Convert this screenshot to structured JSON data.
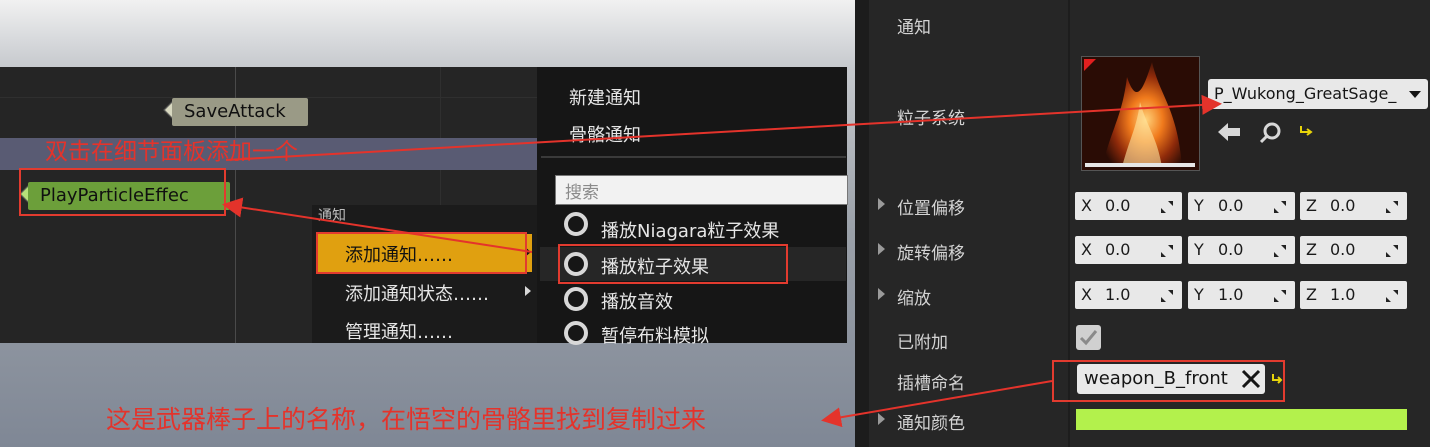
{
  "graph": {
    "notifies": [
      {
        "label": "SaveAttack"
      },
      {
        "label": "PlayParticleEffec"
      }
    ]
  },
  "context_menu": {
    "header": "通知",
    "items": [
      {
        "label": "添加通知……",
        "selected": true,
        "has_submenu": true
      },
      {
        "label": "添加通知状态……",
        "has_submenu": true
      },
      {
        "label": "管理通知……"
      }
    ]
  },
  "submenu": {
    "top_items": [
      "新建通知",
      "骨骼通知"
    ],
    "search_placeholder": "搜索",
    "items": [
      {
        "label": "播放Niagara粒子效果"
      },
      {
        "label": "播放粒子效果",
        "highlighted": true
      },
      {
        "label": "播放音效"
      },
      {
        "label": "暂停布料模拟"
      }
    ]
  },
  "details": {
    "section_notify": "通知",
    "particle_system": {
      "label": "粒子系统",
      "asset": "P_Wukong_GreatSage_"
    },
    "location_offset": {
      "label": "位置偏移",
      "x": "0.0",
      "y": "0.0",
      "z": "0.0"
    },
    "rotation_offset": {
      "label": "旋转偏移",
      "x": "0.0",
      "y": "0.0",
      "z": "0.0"
    },
    "scale": {
      "label": "缩放",
      "x": "1.0",
      "y": "1.0",
      "z": "1.0"
    },
    "attached": {
      "label": "已附加",
      "checked": true
    },
    "socket_name": {
      "label": "插槽命名",
      "value": "weapon_B_front"
    },
    "notify_color": {
      "label": "通知颜色",
      "color": "#b3f14c"
    },
    "axis_labels": {
      "x": "X",
      "y": "Y",
      "z": "Z"
    }
  },
  "annotations": {
    "top": "双击在细节面板添加一个",
    "bottom": "这是武器棒子上的名称，在悟空的骨骼里找到复制过来",
    "color": "#e4332b"
  }
}
